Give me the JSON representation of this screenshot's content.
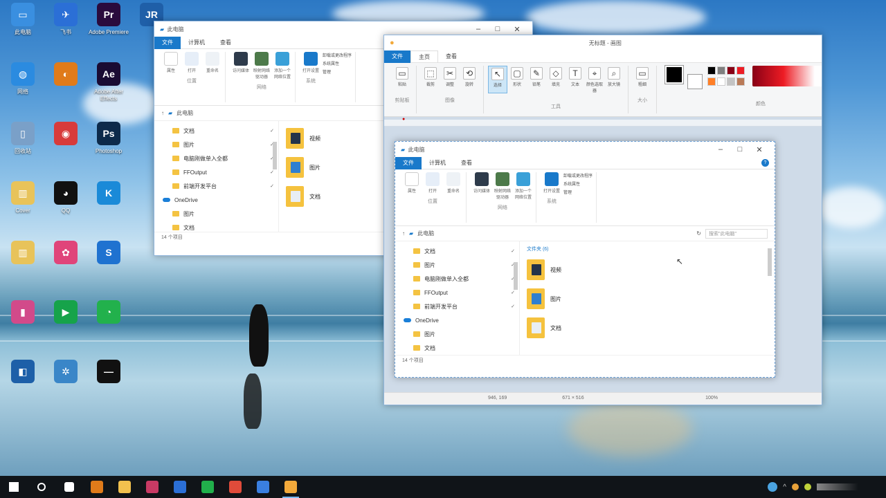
{
  "desktop": {
    "icons": [
      {
        "label": "此电脑",
        "color": "#3a8fe0",
        "glyph": "▭"
      },
      {
        "label": "飞书",
        "color": "#2b6fd6",
        "glyph": "✈"
      },
      {
        "label": "Adobe Premiere",
        "color": "#2a0b3d",
        "glyph": "Pr"
      },
      {
        "label": "",
        "color": "#1f5fa8",
        "glyph": "JR"
      },
      {
        "label": "网络",
        "color": "#2b8be0",
        "glyph": "◍"
      },
      {
        "label": "",
        "color": "#e07b1a",
        "glyph": "◐"
      },
      {
        "label": "Adobe After Effects",
        "color": "#1a0b33",
        "glyph": "Ae"
      },
      {
        "label": "回收站",
        "color": "#7aa0c8",
        "glyph": "▯"
      },
      {
        "label": "",
        "color": "#d83b3b",
        "glyph": "◉"
      },
      {
        "label": "Photoshop",
        "color": "#0d2a4a",
        "glyph": "Ps"
      },
      {
        "label": "Cover",
        "color": "#e8c35a",
        "glyph": "▥"
      },
      {
        "label": "QQ",
        "color": "#111111",
        "glyph": "◕"
      },
      {
        "label": "",
        "color": "#1a8ad8",
        "glyph": "K"
      },
      {
        "label": "",
        "color": "#e8c35a",
        "glyph": "▥"
      },
      {
        "label": "",
        "color": "#e0447a",
        "glyph": "✿"
      },
      {
        "label": "",
        "color": "#1f72d0",
        "glyph": "S"
      },
      {
        "label": "",
        "color": "#d24a8a",
        "glyph": "▮"
      },
      {
        "label": "",
        "color": "#16a34a",
        "glyph": "▶"
      },
      {
        "label": "",
        "color": "#22b14c",
        "glyph": "◔"
      },
      {
        "label": "",
        "color": "#1d5fa8",
        "glyph": "◧"
      },
      {
        "label": "",
        "color": "#3a86c8",
        "glyph": "✲"
      },
      {
        "label": "",
        "color": "#111111",
        "glyph": "—"
      }
    ]
  },
  "explorer_back": {
    "title": "此电脑",
    "tabs": [
      "文件",
      "计算机",
      "查看"
    ],
    "ribbon_groups": [
      {
        "name": "位置",
        "buttons": [
          "属性",
          "打开",
          "重命名"
        ]
      },
      {
        "name": "网络",
        "buttons": [
          "访问媒体",
          "映射网络驱动器",
          "添加一个网络位置"
        ]
      },
      {
        "name": "系统",
        "buttons": [
          "打开设置"
        ]
      }
    ],
    "system_links": [
      "卸载或更改程序",
      "系统属性",
      "管理"
    ],
    "address": "此电脑",
    "nav": [
      "文档",
      "图片",
      "电脑刚做单入全都",
      "FFOutput",
      "前端开发平台",
      "OneDrive",
      "图片",
      "文档"
    ],
    "content": [
      "视频",
      "图片",
      "文档"
    ],
    "status": "14 个项目"
  },
  "paint": {
    "title": "无标题 - 画图",
    "tabs": [
      "文件",
      "主页",
      "查看"
    ],
    "groups": [
      {
        "name": "剪贴板",
        "tools": [
          "粘贴"
        ]
      },
      {
        "name": "图像",
        "tools": [
          "裁剪",
          "调整",
          "旋转"
        ]
      },
      {
        "name": "工具",
        "tools": [
          "选择",
          "形状",
          "铅笔",
          "填充",
          "文本",
          "颜色选取器",
          "放大镜"
        ]
      },
      {
        "name": "大小",
        "tools": [
          "粗细"
        ]
      },
      {
        "name": "颜色",
        "tools": [
          "颜色1"
        ]
      }
    ],
    "tool_glyphs": [
      "▭",
      "⬚",
      "✂",
      "⟲",
      "↖",
      "▢",
      "✎",
      "◇",
      "T",
      "⌖",
      "⌕"
    ],
    "status_pos": "946, 169",
    "status_size": "671 × 516",
    "status_zoom": "100%",
    "colors": [
      "#000000",
      "#7f7f7f",
      "#880015",
      "#ed1c24",
      "#ff7f27",
      "#ffffff",
      "#c3c3c3",
      "#b97a57"
    ]
  },
  "explorer_front": {
    "title": "此电脑",
    "tabs": [
      "文件",
      "计算机",
      "查看"
    ],
    "ribbon_groups": [
      {
        "name": "位置",
        "buttons": [
          "属性",
          "打开",
          "重命名"
        ]
      },
      {
        "name": "网络",
        "buttons": [
          "访问媒体",
          "映射网络驱动器",
          "添加一个网络位置"
        ]
      },
      {
        "name": "系统",
        "buttons": [
          "打开设置"
        ]
      }
    ],
    "system_links": [
      "卸载或更改程序",
      "系统属性",
      "管理"
    ],
    "address": "此电脑",
    "search_placeholder": "搜索\"此电脑\"",
    "section_header": "文件夹 (6)",
    "nav": [
      "文档",
      "图片",
      "电脑刚做单入全都",
      "FFOutput",
      "前端开发平台",
      "OneDrive",
      "图片",
      "文档"
    ],
    "content": [
      "视频",
      "图片",
      "文档"
    ],
    "status": "14 个项目"
  },
  "taskbar": {
    "items": [
      "windows-start",
      "cortana",
      "app-store",
      "wps",
      "file-explorer",
      "red-app",
      "word-app",
      "wechat",
      "chrome",
      "feishu",
      "paint"
    ],
    "colors": [
      "#ffffff",
      "#ffffff",
      "#ffffff",
      "#e07b1a",
      "#f2c14e",
      "#c83a64",
      "#2b6fd6",
      "#21b04b",
      "#e04b3a",
      "#3a7fe0",
      "#f2a93b"
    ]
  }
}
